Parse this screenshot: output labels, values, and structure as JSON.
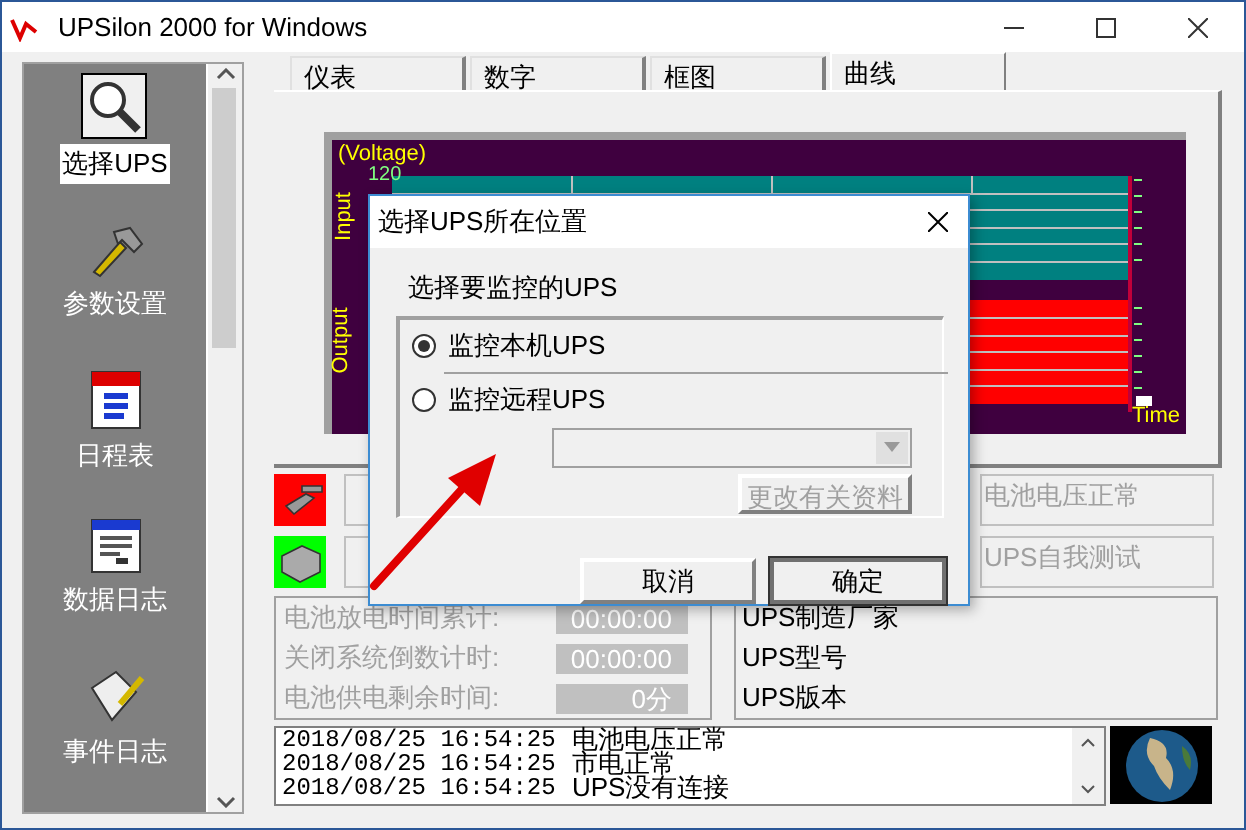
{
  "window": {
    "title": "UPSilon 2000 for Windows"
  },
  "sidebar": {
    "items": [
      {
        "label": "选择UPS",
        "selected": true,
        "kind": "search"
      },
      {
        "label": "参数设置",
        "selected": false,
        "kind": "hammer"
      },
      {
        "label": "日程表",
        "selected": false,
        "kind": "calendar"
      },
      {
        "label": "数据日志",
        "selected": false,
        "kind": "document"
      },
      {
        "label": "事件日志",
        "selected": false,
        "kind": "scroll"
      }
    ]
  },
  "tabs": [
    {
      "label": "仪表",
      "selected": false
    },
    {
      "label": "数字",
      "selected": false
    },
    {
      "label": "框图",
      "selected": false
    },
    {
      "label": "曲线",
      "selected": true
    }
  ],
  "chart": {
    "axis_label": "(Voltage)",
    "ticks": [
      "120"
    ],
    "input_label": "Input",
    "output_label": "Output",
    "time_label": "Time"
  },
  "status": [
    {
      "kind": "cable",
      "color": "#ff0000",
      "message": "电池电压正常"
    },
    {
      "kind": "ups",
      "color": "#00ff00",
      "message": "UPS自我测试"
    }
  ],
  "timers": [
    {
      "label": "电池放电时间累计:",
      "value": "00:00:00"
    },
    {
      "label": "关闭系统倒数计时:",
      "value": "00:00:00"
    },
    {
      "label": "电池供电剩余时间:",
      "value": "0分"
    }
  ],
  "ups_info": [
    "UPS制造厂家",
    "UPS型号",
    "UPS版本"
  ],
  "log": [
    {
      "timestamp": "2018/08/25  16:54:25",
      "message": "电池电压正常"
    },
    {
      "timestamp": "2018/08/25  16:54:25",
      "message": "市电正常"
    },
    {
      "timestamp": "2018/08/25  16:54:25",
      "message": "UPS没有连接"
    }
  ],
  "dialog": {
    "title": "选择UPS所在位置",
    "group_label": "选择要监控的UPS",
    "options": [
      {
        "label": "监控本机UPS",
        "selected": true
      },
      {
        "label": "监控远程UPS",
        "selected": false
      }
    ],
    "remote_combo": {
      "disabled": true
    },
    "edit_button": {
      "label": "更改有关资料",
      "disabled": true
    },
    "buttons": [
      {
        "label": "取消",
        "default": false
      },
      {
        "label": "确定",
        "default": true
      }
    ]
  }
}
